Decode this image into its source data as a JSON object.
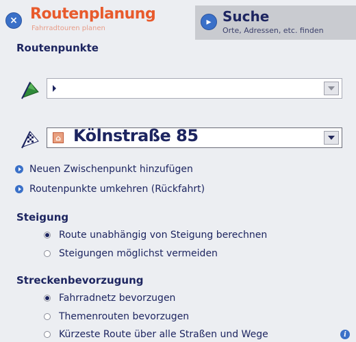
{
  "tabs": {
    "route": {
      "title": "Routenplanung",
      "subtitle": "Fahrradtouren planen"
    },
    "search": {
      "title": "Suche",
      "subtitle": "Orte, Adressen, etc. finden"
    }
  },
  "routepoints": {
    "heading": "Routenpunkte",
    "start": {
      "value": ""
    },
    "destination": {
      "value": "Kölnstraße 85"
    }
  },
  "actions": {
    "add_waypoint": "Neuen Zwischenpunkt hinzufügen",
    "reverse": "Routenpunkte umkehren (Rückfahrt)"
  },
  "steigung": {
    "heading": "Steigung",
    "options": [
      {
        "label": "Route unabhängig von Steigung berechnen",
        "selected": true
      },
      {
        "label": "Steigungen möglichst vermeiden",
        "selected": false
      }
    ]
  },
  "strecke": {
    "heading": "Streckenbevorzugung",
    "options": [
      {
        "label": "Fahrradnetz bevorzugen",
        "selected": true
      },
      {
        "label": "Themenrouten bevorzugen",
        "selected": false
      },
      {
        "label": "Kürzeste Route über alle Straßen und Wege",
        "selected": false
      }
    ]
  },
  "colors": {
    "accent": "#e85a2c",
    "link": "#1d2560",
    "bullet": "#3a70c8"
  }
}
